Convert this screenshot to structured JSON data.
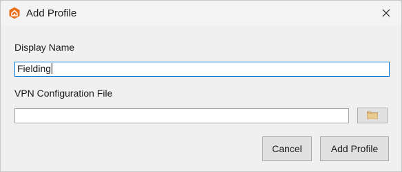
{
  "window": {
    "title": "Add Profile"
  },
  "icons": {
    "app": "orange-hexagon-home-icon",
    "close": "close-icon",
    "browse": "folder-icon"
  },
  "form": {
    "display_name_label": "Display Name",
    "display_name_value": "Fielding",
    "vpn_file_label": "VPN Configuration File",
    "vpn_file_value": ""
  },
  "buttons": {
    "cancel": "Cancel",
    "add_profile": "Add Profile"
  },
  "colors": {
    "app_icon": "#e8701a",
    "focus_border": "#0078d7",
    "folder": "#dcb67a"
  }
}
